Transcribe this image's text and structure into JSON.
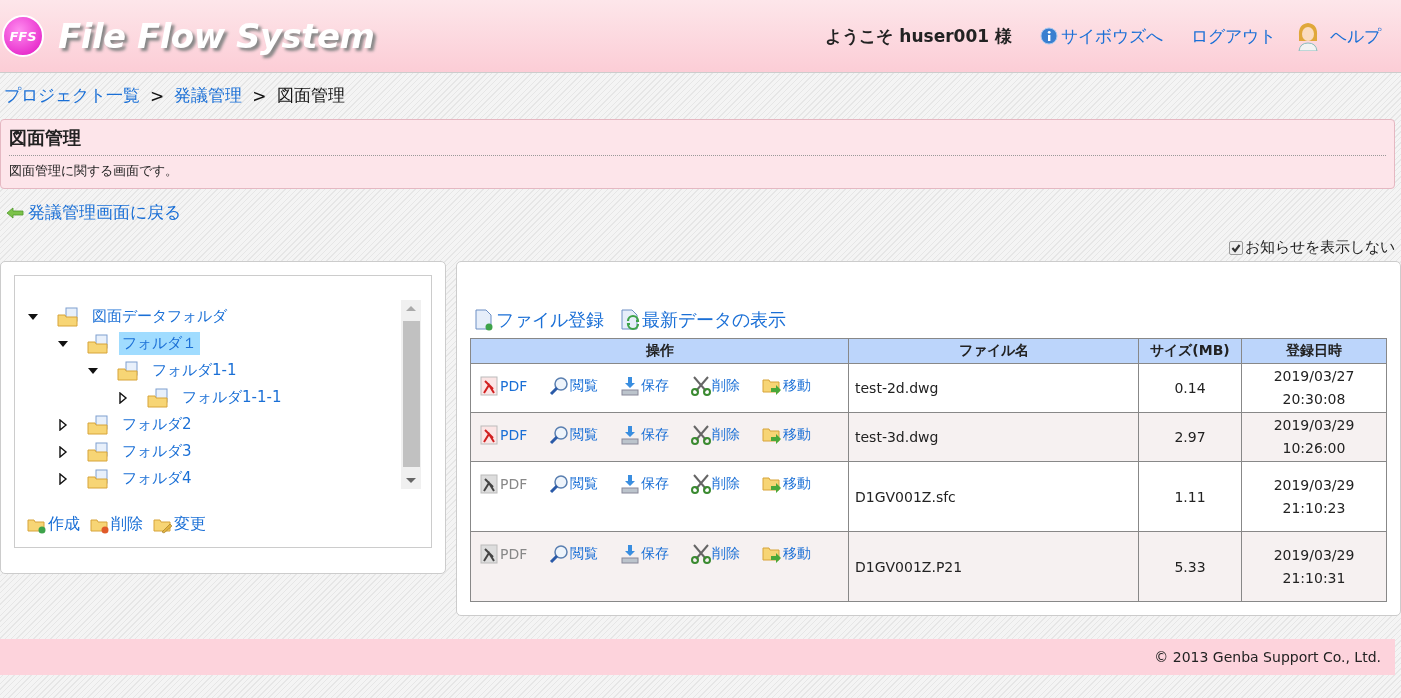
{
  "header": {
    "logo_badge": "FFS",
    "logo_text": "File Flow System",
    "welcome": "ようこそ huser001 様",
    "links": [
      {
        "kind": "info",
        "label": "サイボウズへ"
      },
      {
        "kind": "plain",
        "label": "ログアウト"
      },
      {
        "kind": "help",
        "label": "ヘルプ"
      }
    ]
  },
  "breadcrumb": [
    {
      "label": "プロジェクト一覧",
      "link": true
    },
    {
      "label": ">",
      "link": false
    },
    {
      "label": "発議管理",
      "link": true
    },
    {
      "label": ">",
      "link": false
    },
    {
      "label": "図面管理",
      "link": false
    }
  ],
  "page_box": {
    "title": "図面管理",
    "description": "図面管理に関する画面です。"
  },
  "back_link": "発議管理画面に戻る",
  "hide_notice": {
    "label": "お知らせを表示しない",
    "checked": true
  },
  "folder_tree": {
    "items": [
      {
        "label": "図面データフォルダ",
        "expanded": true,
        "selected": false,
        "children": [
          {
            "label": "フォルダ１",
            "expanded": true,
            "selected": true,
            "children": [
              {
                "label": "フォルダ1-1",
                "expanded": true,
                "selected": false,
                "children": [
                  {
                    "label": "フォルダ1-1-1",
                    "expanded": false,
                    "selected": false
                  }
                ]
              }
            ]
          },
          {
            "label": "フォルダ2",
            "expanded": false,
            "selected": false
          },
          {
            "label": "フォルダ3",
            "expanded": false,
            "selected": false
          },
          {
            "label": "フォルダ4",
            "expanded": false,
            "selected": false
          }
        ]
      }
    ],
    "actions": [
      {
        "kind": "create",
        "label": "作成"
      },
      {
        "kind": "delete",
        "label": "削除"
      },
      {
        "kind": "rename",
        "label": "変更"
      }
    ]
  },
  "file_toolbar": [
    {
      "kind": "register",
      "label": "ファイル登録"
    },
    {
      "kind": "refresh",
      "label": "最新データの表示"
    }
  ],
  "table": {
    "columns": [
      "操作",
      "ファイル名",
      "サイズ(MB)",
      "登録日時"
    ],
    "rows": [
      {
        "actions": [
          {
            "kind": "pdf",
            "label": "PDF",
            "disabled": false
          },
          {
            "kind": "view",
            "label": "閲覧",
            "disabled": false
          },
          {
            "kind": "save",
            "label": "保存",
            "disabled": false
          },
          {
            "kind": "delete",
            "label": "削除",
            "disabled": false
          },
          {
            "kind": "move",
            "label": "移動",
            "disabled": false
          }
        ],
        "file_name": "test-2d.dwg",
        "size": "0.14",
        "date": "2019/03/27",
        "time": "20:30:08"
      },
      {
        "actions": [
          {
            "kind": "pdf",
            "label": "PDF",
            "disabled": false
          },
          {
            "kind": "view",
            "label": "閲覧",
            "disabled": false
          },
          {
            "kind": "save",
            "label": "保存",
            "disabled": false
          },
          {
            "kind": "delete",
            "label": "削除",
            "disabled": false
          },
          {
            "kind": "move",
            "label": "移動",
            "disabled": false
          }
        ],
        "file_name": "test-3d.dwg",
        "size": "2.97",
        "date": "2019/03/29",
        "time": "10:26:00"
      },
      {
        "actions": [
          {
            "kind": "pdf",
            "label": "PDF",
            "disabled": true
          },
          {
            "kind": "view",
            "label": "閲覧",
            "disabled": false
          },
          {
            "kind": "save",
            "label": "保存",
            "disabled": false
          },
          {
            "kind": "delete",
            "label": "削除",
            "disabled": false
          },
          {
            "kind": "move",
            "label": "移動",
            "disabled": false
          }
        ],
        "file_name": "D1GV001Z.sfc",
        "size": "1.11",
        "date": "2019/03/29",
        "time": "21:10:23"
      },
      {
        "actions": [
          {
            "kind": "pdf",
            "label": "PDF",
            "disabled": true
          },
          {
            "kind": "view",
            "label": "閲覧",
            "disabled": false
          },
          {
            "kind": "save",
            "label": "保存",
            "disabled": false
          },
          {
            "kind": "delete",
            "label": "削除",
            "disabled": false
          },
          {
            "kind": "move",
            "label": "移動",
            "disabled": false
          }
        ],
        "file_name": "D1GV001Z.P21",
        "size": "5.33",
        "date": "2019/03/29",
        "time": "21:10:31"
      }
    ]
  },
  "footer": "© 2013 Genba Support Co., Ltd."
}
